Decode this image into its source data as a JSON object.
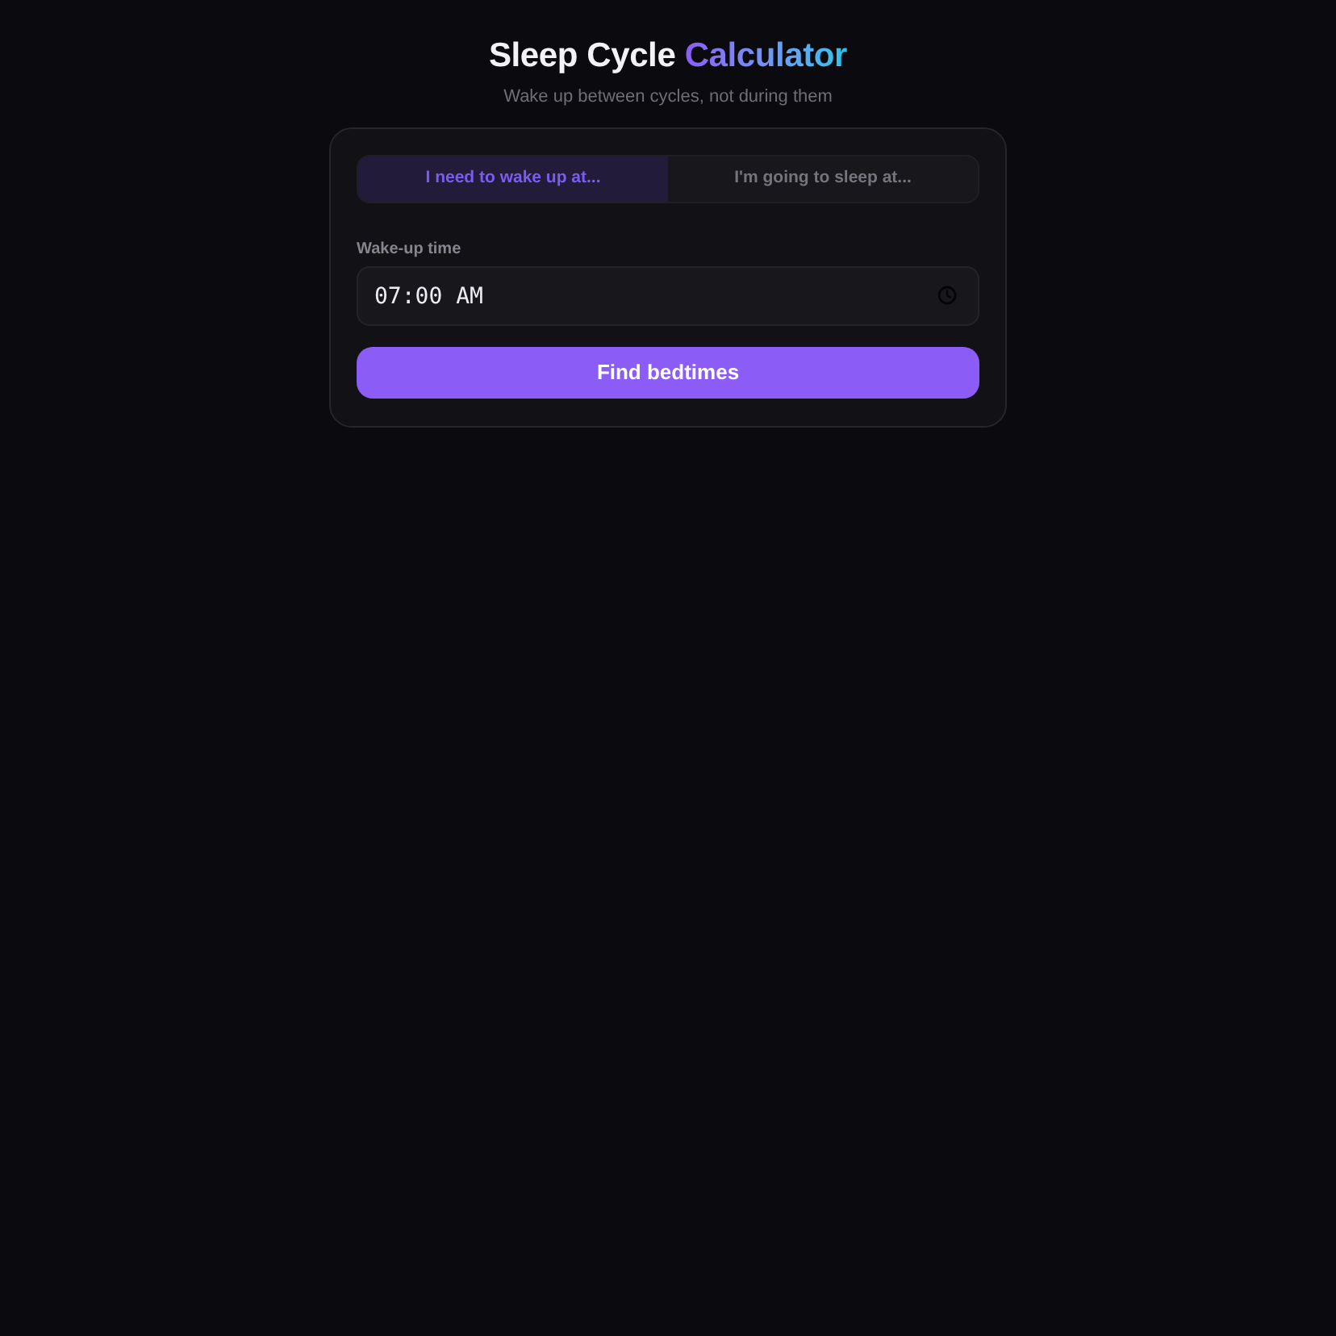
{
  "header": {
    "title_parts": [
      {
        "text": "Sleep Cycle",
        "kind": "plain"
      },
      {
        "text": "Calculator",
        "kind": "accent"
      }
    ],
    "subtitle": "Wake up between cycles, not during them"
  },
  "mode_tabs": [
    {
      "label": "I need to wake up at...",
      "selected": true
    },
    {
      "label": "I'm going to sleep at...",
      "selected": false
    }
  ],
  "time_field": {
    "label": "Wake-up time",
    "value": "07:00 AM"
  },
  "submit_button": {
    "label": "Find bedtimes"
  }
}
